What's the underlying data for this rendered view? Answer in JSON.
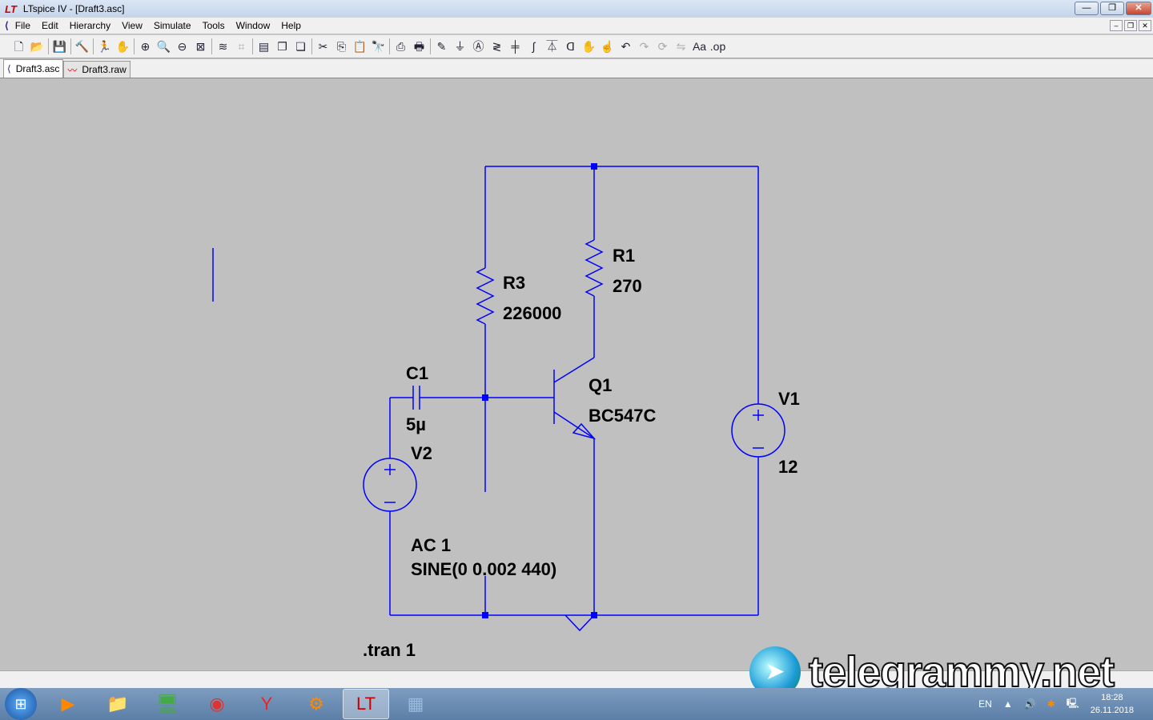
{
  "window": {
    "title": "LTspice IV - [Draft3.asc]",
    "logo": "LT",
    "minimize": "—",
    "restore": "❐",
    "close": "✕"
  },
  "menu": [
    "File",
    "Edit",
    "Hierarchy",
    "View",
    "Simulate",
    "Tools",
    "Window",
    "Help"
  ],
  "toolbar": [
    {
      "name": "new-schematic",
      "g": "🗋"
    },
    {
      "name": "open",
      "g": "📂"
    },
    "|",
    {
      "name": "save",
      "g": "💾"
    },
    "|",
    {
      "name": "control-panel",
      "g": "🔨"
    },
    "|",
    {
      "name": "run",
      "g": "🏃"
    },
    {
      "name": "halt",
      "g": "✋",
      "dis": true
    },
    "|",
    {
      "name": "zoom-in",
      "g": "⊕"
    },
    {
      "name": "zoom-pan",
      "g": "🔍",
      "dis": true
    },
    {
      "name": "zoom-out",
      "g": "⊖"
    },
    {
      "name": "zoom-fit",
      "g": "⊠"
    },
    "|",
    {
      "name": "plot-settings",
      "g": "≋"
    },
    {
      "name": "plot-autorange",
      "g": "⌗",
      "dis": true
    },
    "|",
    {
      "name": "tile-horizontal",
      "g": "▤"
    },
    {
      "name": "cascade",
      "g": "❐"
    },
    {
      "name": "tile-vertical",
      "g": "❏"
    },
    "|",
    {
      "name": "cut",
      "g": "✂"
    },
    {
      "name": "copy",
      "g": "⎘"
    },
    {
      "name": "paste",
      "g": "📋",
      "dis": true
    },
    {
      "name": "find",
      "g": "🔭"
    },
    "|",
    {
      "name": "print-preview",
      "g": "⎙"
    },
    {
      "name": "print",
      "g": "🖶"
    },
    "|",
    {
      "name": "draw-wire",
      "g": "✎"
    },
    {
      "name": "ground",
      "g": "⏚"
    },
    {
      "name": "label-net",
      "g": "Ⓐ"
    },
    {
      "name": "resistor",
      "g": "≷"
    },
    {
      "name": "capacitor",
      "g": "╪"
    },
    {
      "name": "inductor",
      "g": "∫"
    },
    {
      "name": "diode",
      "g": "⏄"
    },
    {
      "name": "component",
      "g": "ᗡ"
    },
    {
      "name": "move",
      "g": "✋"
    },
    {
      "name": "drag",
      "g": "☝"
    },
    {
      "name": "undo",
      "g": "↶"
    },
    {
      "name": "redo",
      "g": "↷",
      "dis": true
    },
    {
      "name": "rotate",
      "g": "⟳",
      "dis": true
    },
    {
      "name": "mirror",
      "g": "⇋",
      "dis": true
    },
    {
      "name": "text",
      "g": "Aa"
    },
    {
      "name": "spice-directive",
      "g": ".op"
    }
  ],
  "tabs": [
    {
      "label": "Draft3.asc",
      "active": true,
      "icon": "⟨"
    },
    {
      "label": "Draft3.raw",
      "active": false,
      "icon": "〰"
    }
  ],
  "schematic": {
    "wire_color": "#0000ff",
    "labels": {
      "r3_name": "R3",
      "r3_value": "226000",
      "r1_name": "R1",
      "r1_value": "270",
      "c1_name": "C1",
      "c1_value": "5µ",
      "v2_name": "V2",
      "q1_name": "Q1",
      "q1_value": "BC547C",
      "v1_name": "V1",
      "v1_value": "12",
      "v2_ac": "AC 1",
      "v2_sine": "SINE(0 0.002 440)",
      "directive": ".tran 1"
    }
  },
  "watermark": {
    "text": "telegrammy.net"
  },
  "taskbar": {
    "apps": [
      {
        "name": "media-player",
        "g": "▶",
        "c": "#f80"
      },
      {
        "name": "explorer",
        "g": "📁",
        "c": "#fc6"
      },
      {
        "name": "monitor",
        "g": "🖥",
        "c": "#4a4"
      },
      {
        "name": "chrome",
        "g": "◉",
        "c": "#d33"
      },
      {
        "name": "yandex",
        "g": "Y",
        "c": "#e22"
      },
      {
        "name": "settings",
        "g": "⚙",
        "c": "#f80"
      },
      {
        "name": "ltspice",
        "g": "LT",
        "c": "#c00",
        "active": true
      },
      {
        "name": "calculator",
        "g": "▦",
        "c": "#9bd"
      }
    ],
    "lang": "EN",
    "time": "18:28",
    "date": "26.11.2018"
  }
}
